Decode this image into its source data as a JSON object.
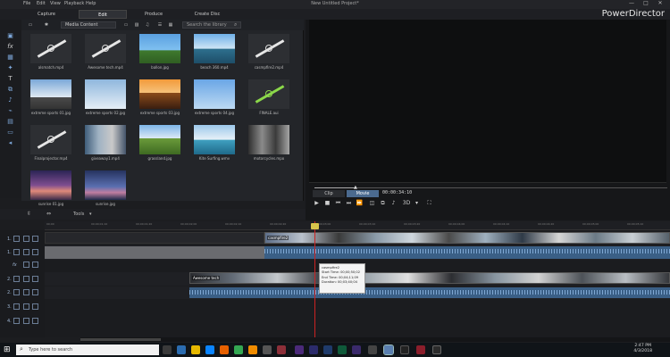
{
  "titlebar": {
    "menus": [
      "File",
      "Edit",
      "View",
      "Playback",
      "Help"
    ],
    "document_title": "New Untitled Project*",
    "controls": [
      "—",
      "□",
      "✕"
    ]
  },
  "modes": {
    "tabs": [
      "Capture",
      "Edit",
      "Produce",
      "Create Disc"
    ],
    "active": "Edit"
  },
  "brand": "PowerDirector",
  "library": {
    "media_dropdown": "Media Content",
    "search_placeholder": "Search the library",
    "items": [
      {
        "label": "alsmatch.mp4",
        "kind": "transition-white"
      },
      {
        "label": "Awesome tech.mp4",
        "kind": "transition-white"
      },
      {
        "label": "ballon.jpg",
        "kind": "image"
      },
      {
        "label": "beach 360.mp4",
        "kind": "image"
      },
      {
        "label": "casmpfire2.mp4",
        "kind": "transition-white"
      },
      {
        "label": "extreme sports 01.jpg",
        "kind": "image"
      },
      {
        "label": "extreme sports 02.jpg",
        "kind": "image"
      },
      {
        "label": "extreme sports 03.jpg",
        "kind": "image"
      },
      {
        "label": "extreme sports 04.jpg",
        "kind": "image"
      },
      {
        "label": "FINALE.aui",
        "kind": "transition-green"
      },
      {
        "label": "Finalprojector.mp4",
        "kind": "transition-white"
      },
      {
        "label": "giveaway1.mp4",
        "kind": "image"
      },
      {
        "label": "grassland.jpg",
        "kind": "image"
      },
      {
        "label": "Kite Surfing.wmv",
        "kind": "image"
      },
      {
        "label": "motorcycles.mpo",
        "kind": "image"
      },
      {
        "label": "sunrise 01.jpg",
        "kind": "image"
      },
      {
        "label": "sunrise.jpg",
        "kind": "image"
      }
    ]
  },
  "preview": {
    "clip_label": "Clip",
    "movie_label": "Movie",
    "active_mode": "Movie",
    "timecode": "00:00:34:10",
    "mode_3d": "3D",
    "playhead_progress": 0.12
  },
  "timeline": {
    "tools_label": "Tools",
    "ruler_ticks": [
      "00;00",
      "00;00;01;10",
      "00;00;01;20",
      "00;00;02;00",
      "00;00;02;10",
      "00;00;02;20",
      "00;00;03;00",
      "00;00;03;10",
      "00;00;03;20",
      "00;00;04;00",
      "00;00;04;10",
      "00;00;04;20",
      "00;00;05;00",
      "00;00;05;10"
    ],
    "tracks": [
      {
        "number": "1."
      },
      {
        "number": "1."
      },
      {
        "number": "2."
      },
      {
        "number": "2."
      },
      {
        "number": "3."
      },
      {
        "number": "4."
      }
    ],
    "clip_labels": [
      "casmpfire2",
      "Awesome tech"
    ],
    "tooltip": {
      "name": "casmpfire2",
      "start": "Start Time: 00;00;50;02",
      "end": "End Time: 00;04;11;09",
      "duration": "Duration: 00;03;40;04"
    }
  },
  "taskbar": {
    "search_placeholder": "Type here to search",
    "time": "2:47 PM",
    "date": "4/3/2018"
  },
  "colors": {
    "accent_blue": "#3a5f86",
    "active_tab": "#2f3136",
    "playhead": "#cc2222"
  }
}
